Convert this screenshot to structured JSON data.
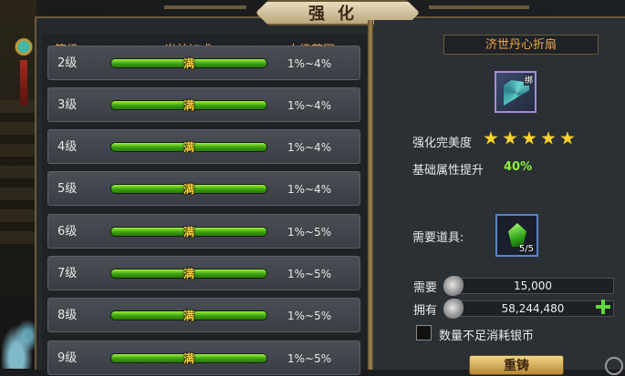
{
  "title": "强化",
  "table": {
    "headers": {
      "level": "等级",
      "bonus": "当前加成",
      "range": "本级范围"
    },
    "rows": [
      {
        "level": "2级",
        "bonus": "满",
        "range": "1%~4%",
        "progress": 1.0
      },
      {
        "level": "3级",
        "bonus": "满",
        "range": "1%~4%",
        "progress": 1.0
      },
      {
        "level": "4级",
        "bonus": "满",
        "range": "1%~4%",
        "progress": 1.0
      },
      {
        "level": "5级",
        "bonus": "满",
        "range": "1%~4%",
        "progress": 1.0
      },
      {
        "level": "6级",
        "bonus": "满",
        "range": "1%~5%",
        "progress": 1.0
      },
      {
        "level": "7级",
        "bonus": "满",
        "range": "1%~5%",
        "progress": 1.0
      },
      {
        "level": "8级",
        "bonus": "满",
        "range": "1%~5%",
        "progress": 1.0
      },
      {
        "level": "9级",
        "bonus": "满",
        "range": "1%~5%",
        "progress": 1.0
      }
    ]
  },
  "item": {
    "name": "济世丹心折扇",
    "badge": "绑",
    "icon": "fan-icon",
    "perfection_label": "强化完美度",
    "perfection_stars": 5,
    "attr_label": "基础属性提升",
    "attr_value": "40%"
  },
  "required": {
    "label": "需要道具:",
    "icon": "green-gem-icon",
    "count": "5/5"
  },
  "cost": {
    "need_label": "需要",
    "need_value": "15,000",
    "have_label": "拥有",
    "have_value": "58,244,480",
    "coin_icon": "silver-coin-icon"
  },
  "option": {
    "label": "数量不足消耗银币",
    "checked": false
  },
  "button": {
    "label": "重铸"
  },
  "colors": {
    "accent": "#f2a64a",
    "bar": "#3aa011",
    "percent": "#8cf03a",
    "star": "#ffd22e"
  }
}
